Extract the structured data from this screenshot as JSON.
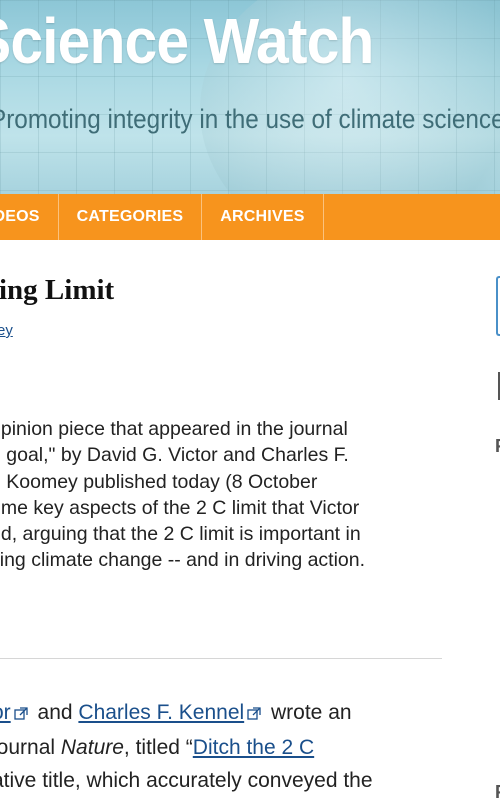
{
  "header": {
    "site_title": "Science Watch",
    "tagline": "Promoting integrity in the use of climate science in"
  },
  "nav": {
    "items": [
      {
        "label": "VIDEOS"
      },
      {
        "label": "CATEGORIES"
      },
      {
        "label": "ARCHIVES"
      }
    ]
  },
  "post": {
    "title": "ing Limit",
    "author": "ey",
    "intro_lines": [
      "opinion piece that appeared in the journal",
      "g goal,\" by David G. Victor and Charles F.",
      "e Koomey published today (8 October",
      "ome key aspects of the 2 C limit that Victor",
      "ed, arguing that the 2 C limit is important in",
      "sing climate change -- and in driving action."
    ],
    "body": {
      "link_victor": "or",
      "and_text": " and ",
      "link_kennel": "Charles F. Kennel",
      "wrote_text": " wrote an",
      "line2_prefix": "journal ",
      "nature": "Nature",
      "titled_text": ", titled “",
      "link_ditch": "Ditch the 2 C",
      "line3": "ative title, which accurately conveyed the"
    }
  },
  "sidebar": {
    "f_letter_1": "F",
    "f_letter_2": "F"
  },
  "colors": {
    "nav_bg": "#f7941d",
    "link": "#1a4f8b",
    "banner": "#a9d8e3"
  }
}
